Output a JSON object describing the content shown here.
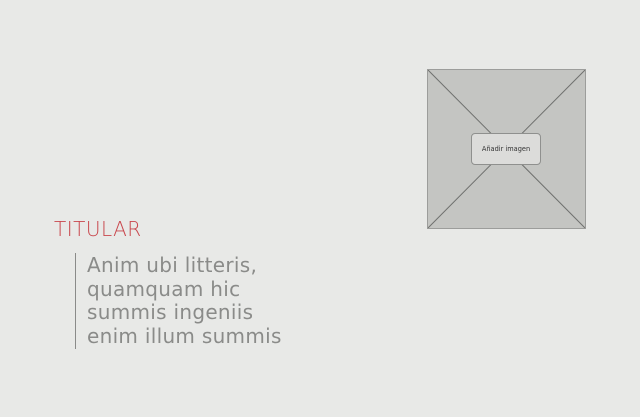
{
  "heading": {
    "title": "TITULAR"
  },
  "quote": {
    "lines": [
      "Anim ubi litteris,",
      "quamquam hic",
      "summis ingeniis",
      "enim illum summis"
    ]
  },
  "image_placeholder": {
    "button_label": "Añadir imagen"
  },
  "colors": {
    "background": "#e8e9e7",
    "title_accent": "#c9474d",
    "body_text": "#8a8b89",
    "placeholder_fill": "#c4c5c2"
  }
}
